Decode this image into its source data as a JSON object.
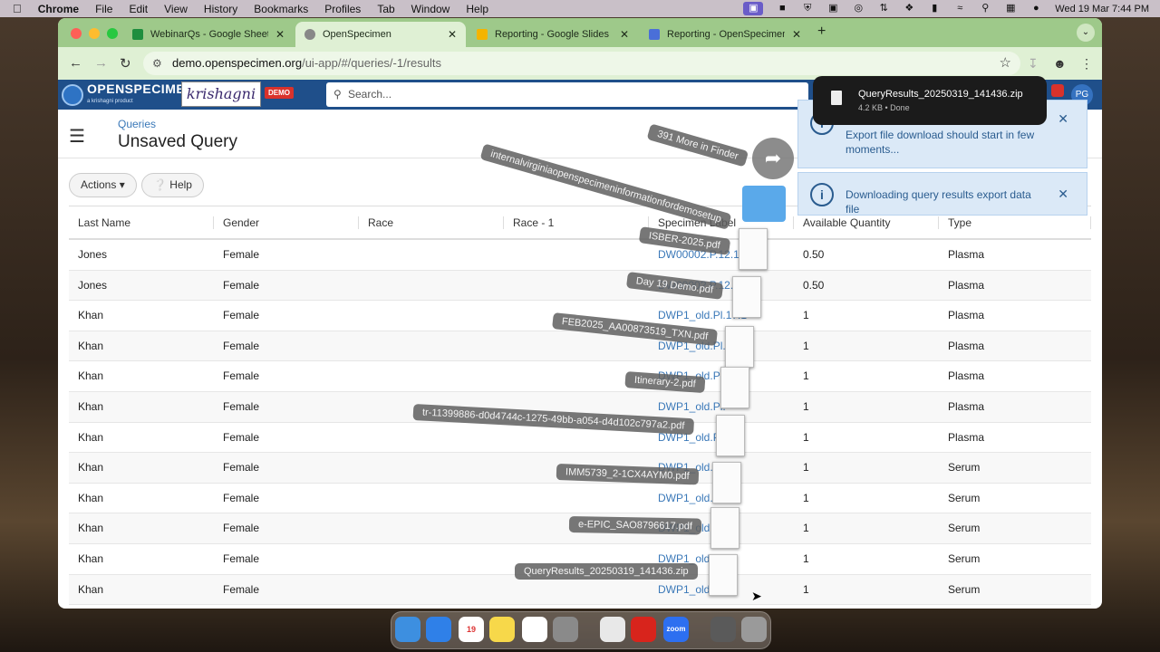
{
  "menubar": {
    "app": "Chrome",
    "items": [
      "File",
      "Edit",
      "View",
      "History",
      "Bookmarks",
      "Profiles",
      "Tab",
      "Window",
      "Help"
    ],
    "datetime": "Wed 19 Mar  7:44 PM"
  },
  "tabs": [
    {
      "label": "WebinarQs - Google Sheets",
      "color": "#1e8e3e"
    },
    {
      "label": "OpenSpecimen",
      "color": "#666666"
    },
    {
      "label": "Reporting - Google Slides",
      "color": "#f4b400"
    },
    {
      "label": "Reporting - OpenSpecimen",
      "color": "#4a6fd8"
    }
  ],
  "address": {
    "host": "demo.openspecimen.org",
    "path": "/ui-app/#/queries/-1/results"
  },
  "app_header": {
    "logo_text": "OPENSPECIMEN",
    "logo_sub": "a krishagni product",
    "brand": "krishagni",
    "demo_badge": "DEMO",
    "search_placeholder": "Search...",
    "avatar": "PG"
  },
  "page": {
    "breadcrumb": "Queries",
    "title": "Unsaved Query",
    "actions_label": "Actions",
    "help_label": "Help"
  },
  "table": {
    "columns": [
      "Last Name",
      "Gender",
      "Race",
      "Race - 1",
      "Specimen Label",
      "Available Quantity",
      "Type"
    ],
    "rows": [
      [
        "Jones",
        "Female",
        "",
        "",
        "DW00002.P.12.1",
        "0.50",
        "Plasma"
      ],
      [
        "Jones",
        "Female",
        "",
        "",
        "DW0000?.P.12.1",
        "0.50",
        "Plasma"
      ],
      [
        "Khan",
        "Female",
        "",
        "",
        "DWP1_old.Pl.17.1",
        "1",
        "Plasma"
      ],
      [
        "Khan",
        "Female",
        "",
        "",
        "DWP1_old.Pl.1",
        "1",
        "Plasma"
      ],
      [
        "Khan",
        "Female",
        "",
        "",
        "DWP1_old.Pl.",
        "1",
        "Plasma"
      ],
      [
        "Khan",
        "Female",
        "",
        "",
        "DWP1_old.Pl.",
        "1",
        "Plasma"
      ],
      [
        "Khan",
        "Female",
        "",
        "",
        "DWP1_old.Pl.",
        "1",
        "Plasma"
      ],
      [
        "Khan",
        "Female",
        "",
        "",
        "DWP1_old.S.1",
        "1",
        "Serum"
      ],
      [
        "Khan",
        "Female",
        "",
        "",
        "DWP1_old.S.2",
        "1",
        "Serum"
      ],
      [
        "Khan",
        "Female",
        "",
        "",
        "DWP1_old.S.3",
        "1",
        "Serum"
      ],
      [
        "Khan",
        "Female",
        "",
        "",
        "DWP1_old.S.4",
        "1",
        "Serum"
      ],
      [
        "Khan",
        "Female",
        "",
        "",
        "DWP1_old.S.5",
        "1",
        "Serum"
      ]
    ]
  },
  "drag_stack": {
    "more_label": "391 More in Finder",
    "folder_label": "internalvirginiaopenspecimeninformationfordemosetup",
    "files": [
      "ISBER-2025.pdf",
      "Day 19 Demo.pdf",
      "FEB2025_AA00873519_TXN.pdf",
      "Itinerary-2.pdf",
      "tr-11399886-d0d4744c-1275-49bb-a054-d4d102c797a2.pdf",
      "IMM5739_2-1CX4AYM0.pdf",
      "e-EPIC_SAO8796617.pdf",
      "QueryResults_20250319_141436.zip"
    ]
  },
  "download": {
    "filename": "QueryResults_20250319_141436.zip",
    "meta": "4.2 KB • Done"
  },
  "notifications": [
    {
      "message": "Export file download should start in few moments..."
    },
    {
      "message": "Downloading query results export data file"
    }
  ],
  "dock": [
    {
      "name": "finder",
      "color": "#3d8fe0"
    },
    {
      "name": "safari",
      "color": "#2f80e8"
    },
    {
      "name": "calendar",
      "color": "#ffffff",
      "label": "19"
    },
    {
      "name": "notes",
      "color": "#f7d84a"
    },
    {
      "name": "freeform",
      "color": "#ffffff"
    },
    {
      "name": "settings",
      "color": "#8a8a8a"
    },
    {
      "name": "chrome",
      "color": "#e8e8e8"
    },
    {
      "name": "acrobat",
      "color": "#d8241c"
    },
    {
      "name": "zoom",
      "color": "#2d6ff0",
      "label": "zoom"
    },
    {
      "name": "downloads",
      "color": "#5a5a5a"
    },
    {
      "name": "trash",
      "color": "#9a9a9a"
    }
  ]
}
